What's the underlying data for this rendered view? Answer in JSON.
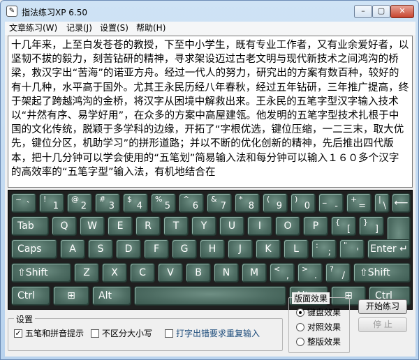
{
  "window": {
    "title": "指法练习XP 6.50",
    "minimize": "–",
    "maximize": "▢",
    "close": "✕"
  },
  "menu": [
    "文章练习(W)",
    "记录(J)",
    "设置(S)",
    "帮助(H)"
  ],
  "text": "十几年来，上至白发苍苍的教授，下至中小学生，既有专业工作者，又有业余爱好者，以坚韧不拔的毅力，刻苦钻研的精神，寻求架设迈过古老文明与现代新技术之间鸿沟的桥梁，救汉字出“苦海”的诺亚方舟。经过一代人的努力，研究出的方案有数百种，较好的有十几种，水平高于国外。尤其王永民历经八年春秋，经过五年钻研，三年推广提高，终于架起了跨越鸿沟的金桥，将汉字从困境中解救出来。王永民的五笔字型汉字输入技术以“井然有序、易学好用”，在众多的方案中高屋建瓴。他发明的五笔字型技术扎根于中国的文化传统，脱颖于多学科的边缘，开拓了“字根优选，键位压缩，一二三末，取大优先，键位分区，机助学习”的拼形道路；并以不断的优化创新的精神，先后推出四代版本，把十几分钟可以学会使用的“五笔划”简易输入法和每分钟可以输入１６０多个汉字的高效率的“五笔字型”输入法，有机地结合在",
  "keyboard": {
    "row1": [
      {
        "top": "~",
        "bot": "`"
      },
      {
        "top": "!",
        "bot": "1"
      },
      {
        "top": "@",
        "bot": "2"
      },
      {
        "top": "#",
        "bot": "3"
      },
      {
        "top": "$",
        "bot": "4"
      },
      {
        "top": "%",
        "bot": "5"
      },
      {
        "top": "^",
        "bot": "6"
      },
      {
        "top": "&",
        "bot": "7"
      },
      {
        "top": "*",
        "bot": "8"
      },
      {
        "top": "(",
        "bot": "9"
      },
      {
        "top": ")",
        "bot": "0"
      },
      {
        "top": "_",
        "bot": "-"
      },
      {
        "top": "+",
        "bot": "="
      },
      {
        "top": "|",
        "bot": "\\"
      }
    ],
    "backspace": "⟵",
    "tab": "Tab",
    "row2": [
      "Q",
      "W",
      "E",
      "R",
      "T",
      "Y",
      "U",
      "I",
      "O",
      "P"
    ],
    "row2_brackets": [
      {
        "top": "{",
        "bot": "["
      },
      {
        "top": "}",
        "bot": "]"
      }
    ],
    "caps": "Caps",
    "row3": [
      "A",
      "S",
      "D",
      "F",
      "G",
      "H",
      "J",
      "K",
      "L"
    ],
    "row3_punct": [
      {
        "top": ":",
        "bot": ";"
      },
      {
        "top": "\"",
        "bot": "'"
      }
    ],
    "enter": "Enter ↵",
    "shift_left": "⇧Shift",
    "row4": [
      "Z",
      "X",
      "C",
      "V",
      "B",
      "N",
      "M"
    ],
    "row4_punct": [
      {
        "top": "<",
        "bot": ","
      },
      {
        "top": ">",
        "bot": "."
      },
      {
        "top": "?",
        "bot": "/"
      }
    ],
    "shift_right": "⇧Shift",
    "ctrl": "Ctrl",
    "alt": "Alt",
    "win": "⊞"
  },
  "settings": {
    "title": "设置",
    "wubi_pinyin": "五笔和拼音提示",
    "case_insensitive": "不区分大小写",
    "retype_on_error": "打字出错要求重复输入",
    "wubi_pinyin_checked": true,
    "case_insensitive_checked": false,
    "retype_on_error_checked": false
  },
  "effect": {
    "title": "版面效果",
    "options": [
      "键盘效果",
      "对照效果",
      "整版效果"
    ],
    "selected": 0
  },
  "buttons": {
    "start": "开始练习",
    "stop": "停 止"
  },
  "colors": {
    "key_face": "#4e6d63",
    "keyboard_bg": "#1f1f1f"
  }
}
